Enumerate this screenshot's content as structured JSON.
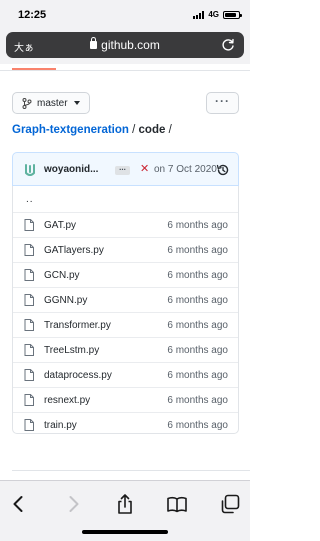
{
  "status": {
    "time": "12:25",
    "network": "4G"
  },
  "browser": {
    "text_size_label": "大ぁ",
    "domain": "github.com"
  },
  "repo": {
    "branch": "master",
    "more_label": "···",
    "breadcrumb_repo": "Graph-textgeneration",
    "breadcrumb_sep1": " / ",
    "breadcrumb_dir": "code",
    "breadcrumb_sep2": " /"
  },
  "commit": {
    "author": "woyaonid...",
    "ellipsis": "...",
    "status_symbol": "✕",
    "date": "on 7 Oct 2020"
  },
  "files": {
    "parent": "..",
    "items": [
      {
        "name": "GAT.py",
        "age": "6 months ago"
      },
      {
        "name": "GATlayers.py",
        "age": "6 months ago"
      },
      {
        "name": "GCN.py",
        "age": "6 months ago"
      },
      {
        "name": "GGNN.py",
        "age": "6 months ago"
      },
      {
        "name": "Transformer.py",
        "age": "6 months ago"
      },
      {
        "name": "TreeLstm.py",
        "age": "6 months ago"
      },
      {
        "name": "dataprocess.py",
        "age": "6 months ago"
      },
      {
        "name": "resnext.py",
        "age": "6 months ago"
      },
      {
        "name": "train.py",
        "age": "6 months ago"
      }
    ]
  },
  "colors": {
    "link": "#0366d6",
    "accent_underline": "#f9826c",
    "commit_bg": "#f1f8ff",
    "fail": "#cb2431"
  },
  "toolbar": {
    "icons": [
      "back-icon",
      "forward-icon",
      "share-icon",
      "bookmarks-icon",
      "tabs-icon"
    ]
  }
}
